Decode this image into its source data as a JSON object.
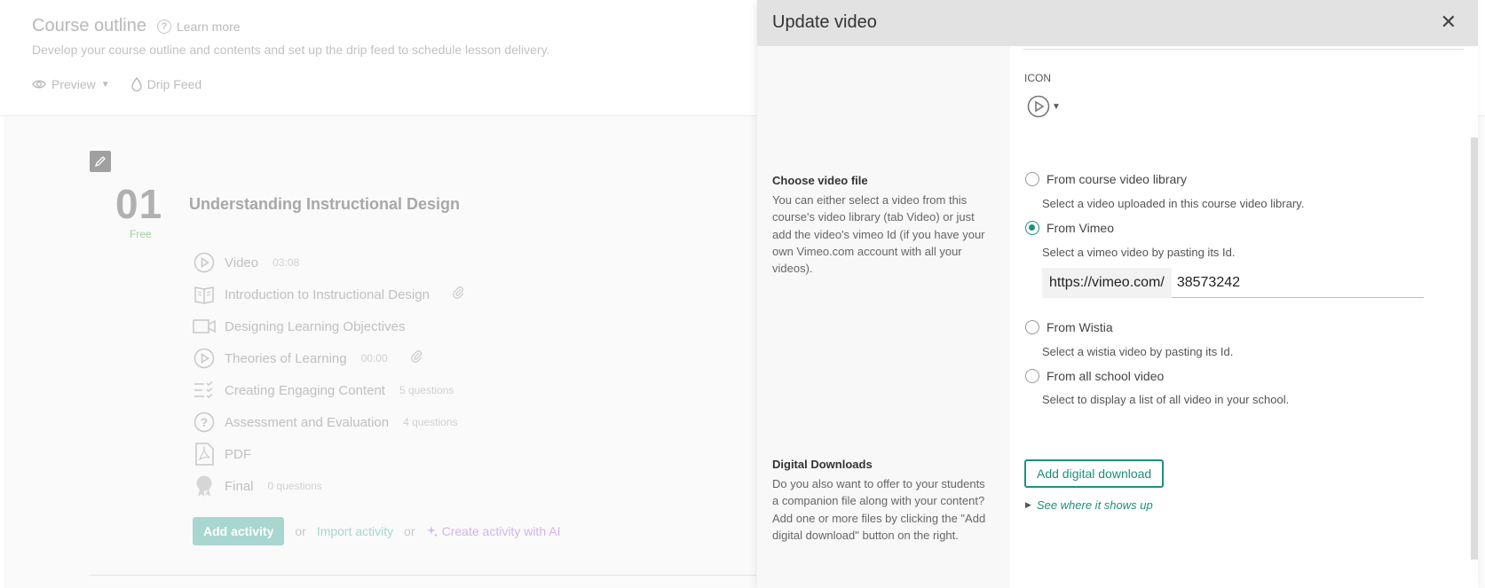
{
  "background": {
    "course_title": "Course outline",
    "learn_more": "Learn more",
    "description": "Develop your course outline and contents and set up the drip feed to schedule lesson delivery.",
    "preview_label": "Preview",
    "drip_feed_label": "Drip Feed",
    "section": {
      "number": "01",
      "free_label": "Free",
      "title": "Understanding Instructional Design"
    },
    "lessons": [
      {
        "name": "Video",
        "meta": "03:08",
        "icon": "play-circle-icon",
        "clip": false
      },
      {
        "name": "Introduction to Instructional Design",
        "meta": "",
        "icon": "book-icon",
        "clip": true
      },
      {
        "name": "Designing Learning Objectives",
        "meta": "",
        "icon": "video-camera-icon",
        "clip": false
      },
      {
        "name": "Theories of Learning",
        "meta": "00:00",
        "icon": "play-circle-icon",
        "clip": true
      },
      {
        "name": "Creating Engaging Content",
        "meta": "5 questions",
        "icon": "checklist-icon",
        "clip": false
      },
      {
        "name": "Assessment and Evaluation",
        "meta": "4 questions",
        "icon": "question-circle-icon",
        "clip": false
      },
      {
        "name": "PDF",
        "meta": "",
        "icon": "pdf-icon",
        "clip": false
      },
      {
        "name": "Final",
        "meta": "0 questions",
        "icon": "award-icon",
        "clip": false
      }
    ],
    "add_activity": "Add activity",
    "or1": "or",
    "import_activity": "Import activity",
    "or2": "or",
    "create_ai": "Create activity with AI"
  },
  "panel": {
    "title": "Update video",
    "close": "✕",
    "icon_label": "ICON",
    "video_section": {
      "heading": "Choose video file",
      "help": "You can either select a video from this course's video library (tab Video) or just add the video's vimeo Id (if you have your own Vimeo.com account with all your videos).",
      "options": [
        {
          "label": "From course video library",
          "sub": "Select a video uploaded in this course video library.",
          "checked": false
        },
        {
          "label": "From Vimeo",
          "sub": "Select a vimeo video by pasting its Id.",
          "checked": true
        },
        {
          "label": "From Wistia",
          "sub": "Select a wistia video by pasting its Id.",
          "checked": false
        },
        {
          "label": "From all school video",
          "sub": "Select to display a list of all video in your school.",
          "checked": false
        }
      ],
      "vimeo_prefix": "https://vimeo.com/",
      "vimeo_id": "38573242"
    },
    "downloads_section": {
      "heading": "Digital Downloads",
      "help": "Do you also want to offer to your students a companion file along with your content? Add one or more files by clicking the \"Add digital download\" button on the right.",
      "button": "Add digital download",
      "see_where": "See where it shows up"
    }
  },
  "colors": {
    "accent": "#1e8f7f",
    "header_bg": "#e2e2e2"
  }
}
